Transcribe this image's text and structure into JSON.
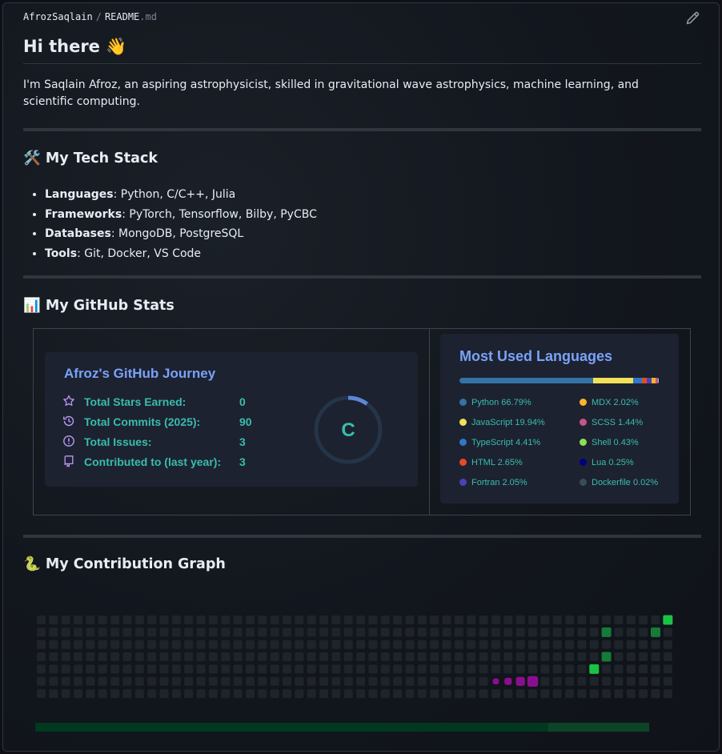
{
  "breadcrumb": {
    "owner": "AfrozSaqlain",
    "separator": "/",
    "file_base": "README",
    "file_ext": ".md"
  },
  "header": {
    "title": "Hi there 👋"
  },
  "intro": "I'm Saqlain Afroz, an aspiring astrophysicist, skilled in gravitational wave astrophysics, machine learning, and scientific computing.",
  "tech": {
    "heading": "🛠️ My Tech Stack",
    "items": [
      {
        "label": "Languages",
        "value": ": Python, C/C++, Julia"
      },
      {
        "label": "Frameworks",
        "value": ": PyTorch, Tensorflow, Bilby, PyCBC"
      },
      {
        "label": "Databases",
        "value": ": MongoDB, PostgreSQL"
      },
      {
        "label": "Tools",
        "value": ": Git, Docker, VS Code"
      }
    ]
  },
  "stats": {
    "heading": "📊 My GitHub Stats",
    "card_title": "Afroz's GitHub Journey",
    "rows": [
      {
        "icon": "star-icon",
        "label": "Total Stars Earned:",
        "value": "0"
      },
      {
        "icon": "history-icon",
        "label": "Total Commits (2025):",
        "value": "90"
      },
      {
        "icon": "issue-icon",
        "label": "Total Issues:",
        "value": "3"
      },
      {
        "icon": "repo-icon",
        "label": "Contributed to (last year):",
        "value": "3"
      }
    ],
    "rank": "C",
    "rank_progress": 0.1,
    "colors": {
      "title": "#7aa2f7",
      "text": "#38bdae",
      "icon": "#bb9af7"
    }
  },
  "languages": {
    "title": "Most Used Languages",
    "items": [
      {
        "name": "Python",
        "percent": "66.79%",
        "value": 66.79,
        "color": "#3572A5"
      },
      {
        "name": "JavaScript",
        "percent": "19.94%",
        "value": 19.94,
        "color": "#f1e05a"
      },
      {
        "name": "TypeScript",
        "percent": "4.41%",
        "value": 4.41,
        "color": "#3178c6"
      },
      {
        "name": "HTML",
        "percent": "2.65%",
        "value": 2.65,
        "color": "#e34c26"
      },
      {
        "name": "Fortran",
        "percent": "2.05%",
        "value": 2.05,
        "color": "#4d41b1"
      },
      {
        "name": "MDX",
        "percent": "2.02%",
        "value": 2.02,
        "color": "#fcb32c"
      },
      {
        "name": "SCSS",
        "percent": "1.44%",
        "value": 1.44,
        "color": "#c6538c"
      },
      {
        "name": "Shell",
        "percent": "0.43%",
        "value": 0.43,
        "color": "#89e051"
      },
      {
        "name": "Lua",
        "percent": "0.25%",
        "value": 0.25,
        "color": "#000080"
      },
      {
        "name": "Dockerfile",
        "percent": "0.02%",
        "value": 0.02,
        "color": "#384d54"
      }
    ]
  },
  "contribution": {
    "heading": "🐍 My Contribution Graph",
    "weeks": 52,
    "days": 7,
    "active_cells": [
      {
        "week": 51,
        "day": 0,
        "kind": "green"
      },
      {
        "week": 46,
        "day": 1,
        "kind": "green-dim"
      },
      {
        "week": 50,
        "day": 1,
        "kind": "green-dim"
      },
      {
        "week": 46,
        "day": 3,
        "kind": "green-dim"
      },
      {
        "week": 45,
        "day": 4,
        "kind": "green"
      }
    ],
    "snake": [
      {
        "week": 37,
        "day": 5,
        "size": 0.55
      },
      {
        "week": 38,
        "day": 5,
        "size": 0.65
      },
      {
        "week": 39,
        "day": 5,
        "size": 0.8
      },
      {
        "week": 40,
        "day": 5,
        "size": 0.95
      }
    ],
    "progress": 0.836,
    "colors": {
      "empty": "#1f242b",
      "green": "#1bc246",
      "green_dim": "#167a38",
      "snake": "#8a0f8f"
    }
  }
}
